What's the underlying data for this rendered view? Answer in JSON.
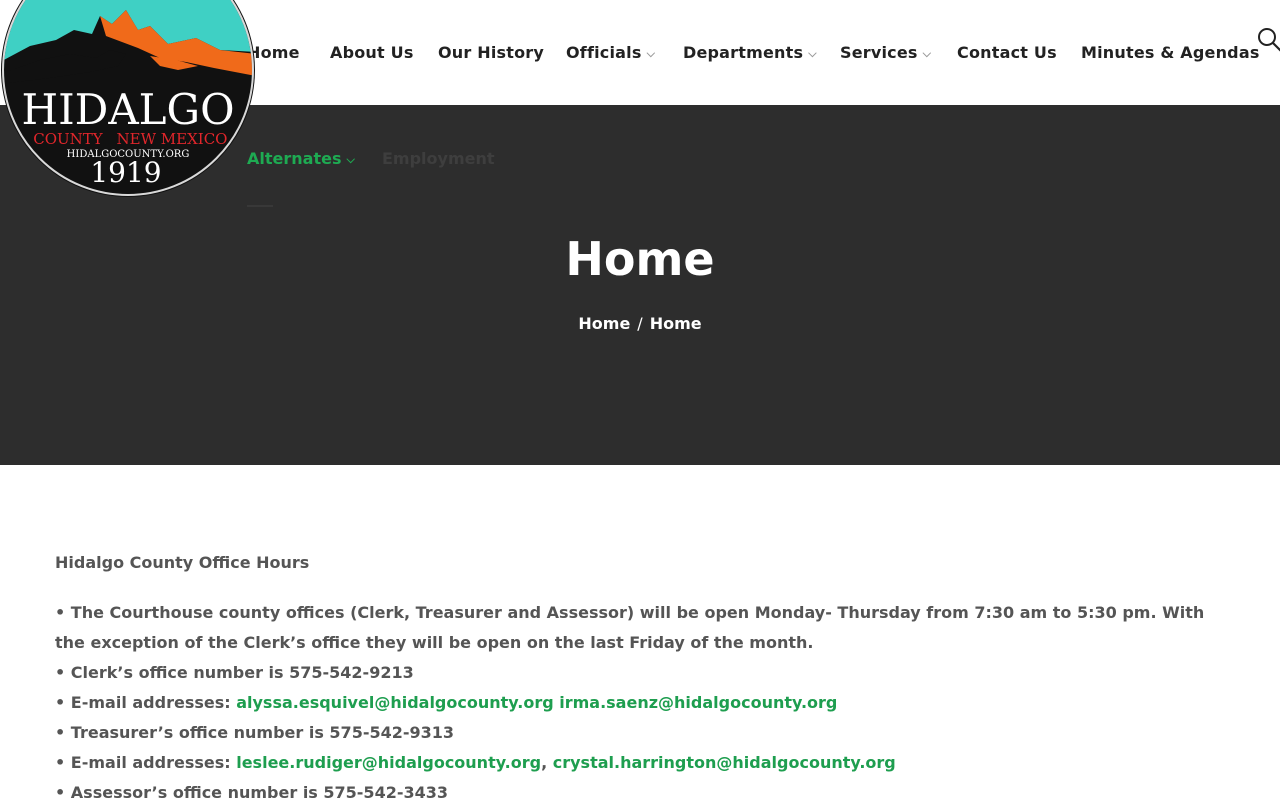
{
  "header": {
    "nav": {
      "home": "Home",
      "about": "About Us",
      "history": "Our History",
      "officials": "Officials",
      "departments": "Departments",
      "services": "Services",
      "contact": "Contact Us",
      "minutes": "Minutes & Agendas"
    },
    "caret": "⌵",
    "nav_secondary": {
      "alternates": "Alternates",
      "faint": "Employment"
    },
    "icons": {
      "search": "search-icon",
      "logo": "county-logo"
    }
  },
  "logo": {
    "name": "HIDALGO",
    "county": "COUNTY",
    "state": "NEW MEXICO",
    "site": "HIDALGOCOUNTY.ORG",
    "year": "1919"
  },
  "hero": {
    "title": "Home",
    "breadcrumb": {
      "home": "Home",
      "sep": "/",
      "current": "Home"
    }
  },
  "content": {
    "heading": "Hidalgo County Office Hours",
    "line1": "• The Courthouse county offices (Clerk, Treasurer and Assessor) will be open Monday- Thursday from 7:30 am to 5:30 pm. With the exception of the Clerk’s office they will be open on the last Friday of the month.",
    "line2": "• Clerk’s office number is 575-542-9213",
    "line3_prefix": "• E-mail addresses: ",
    "email1": "alyssa.esquivel@hidalgocounty.org",
    "email2": "irma.saenz@hidalgocounty.org",
    "line4": "• Treasurer’s office number is 575-542-9313",
    "line5_prefix": "• E-mail addresses: ",
    "email3": "leslee.rudiger@hidalgocounty.org",
    "comma": ",",
    "email4": "crystal.harrington@hidalgocounty.org",
    "line6": "• Assessor’s office number is 575-542-3433"
  },
  "colors": {
    "accent": "#1eaa52",
    "hero_bg": "#2d2d2d",
    "text": "#555555",
    "logo_sky": "#3fd0c4",
    "logo_orange": "#f06a1a"
  }
}
